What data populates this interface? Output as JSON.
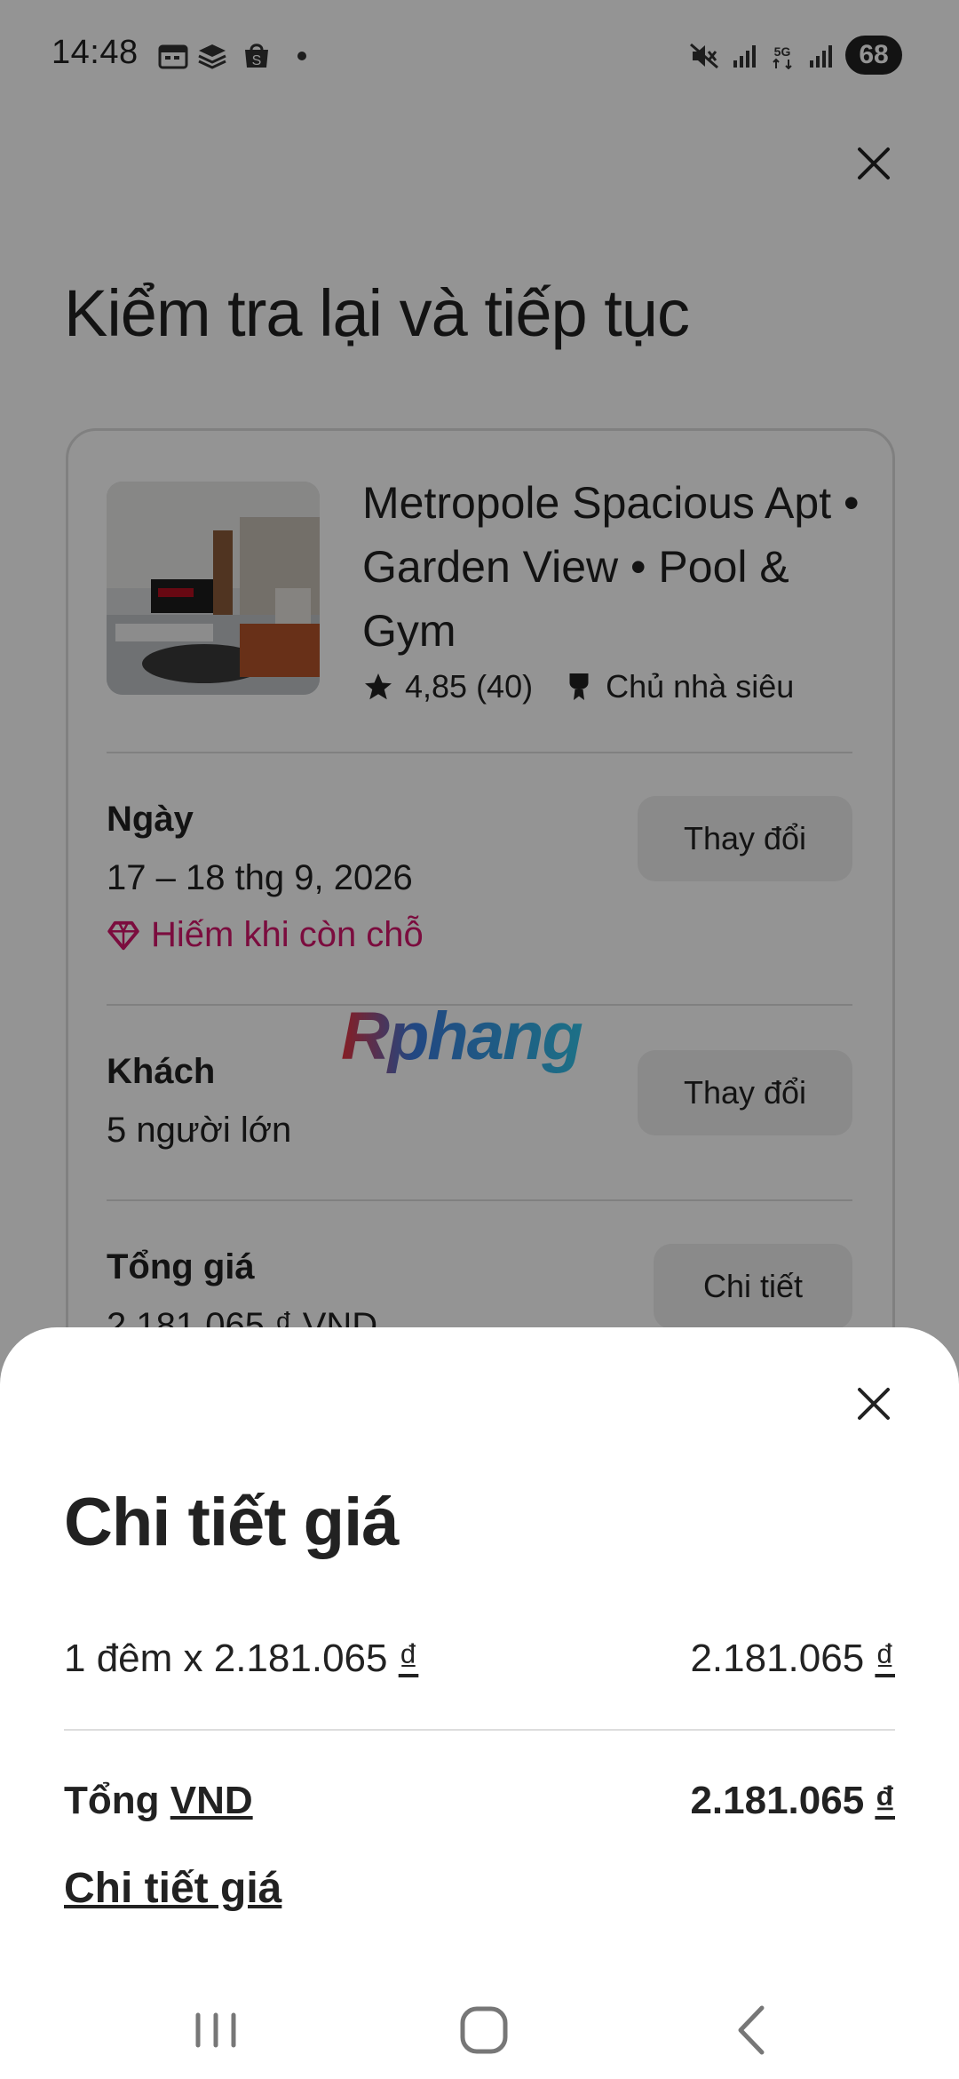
{
  "status_bar": {
    "time": "14:48",
    "battery": "68",
    "icons": [
      "calendar-icon",
      "layers-icon",
      "shopping-bag-icon",
      "dot-icon",
      "mute-icon",
      "signal-icon",
      "5g-icon",
      "signal-icon"
    ]
  },
  "background_page": {
    "title": "Kiểm tra lại và tiếp tục",
    "listing": {
      "title": "Metropole Spacious Apt • Garden View • Pool & Gym",
      "rating": "4,85 (40)",
      "host_badge": "Chủ nhà siêu"
    },
    "dates": {
      "label": "Ngày",
      "value": "17 – 18 thg 9, 2026",
      "rare_notice": "Hiếm khi còn chỗ",
      "change_button": "Thay đổi"
    },
    "guests": {
      "label": "Khách",
      "value": "5 người lớn",
      "change_button": "Thay đổi"
    },
    "total": {
      "label": "Tổng giá",
      "value": "2.181.065 ₫ VND",
      "details_button": "Chi tiết"
    },
    "watermark": "Rphang"
  },
  "sheet": {
    "title": "Chi tiết giá",
    "line_item": {
      "label_prefix": "1 đêm x 2.181.065 ",
      "label_currency": "₫",
      "amount": "2.181.065 ",
      "amount_currency": "₫"
    },
    "total": {
      "label_prefix": "Tổng ",
      "label_currency": "VND",
      "amount": "2.181.065 ",
      "amount_currency": "₫"
    },
    "details_link": "Chi tiết giá"
  },
  "colors": {
    "accent": "#d4156b",
    "text": "#222222",
    "divider": "#dddddd"
  }
}
